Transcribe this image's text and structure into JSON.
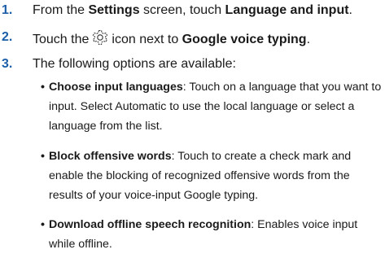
{
  "steps": [
    {
      "num": "1.",
      "pre": "From the ",
      "b1": "Settings",
      "mid": " screen, touch ",
      "b2": "Language and input",
      "post": "."
    },
    {
      "num": "2.",
      "pre": "Touch the",
      "icon": "gear-icon",
      "mid": "icon next to ",
      "b1": "Google voice typing",
      "post": "."
    },
    {
      "num": "3.",
      "text": "The following options are available:"
    }
  ],
  "options": [
    {
      "title": "Choose input languages",
      "desc": ": Touch on a language that you want to input. Select Automatic to use the local language or select a language from the list."
    },
    {
      "title": "Block offensive words",
      "desc": ": Touch to create a check mark and enable the blocking of recognized offensive words from the results of your voice-input Google typing."
    },
    {
      "title": "Download offline speech recognition",
      "desc": ": Enables voice input while offline."
    }
  ],
  "colors": {
    "step_number": "#1c5fa8",
    "text": "#1a1a1a"
  }
}
